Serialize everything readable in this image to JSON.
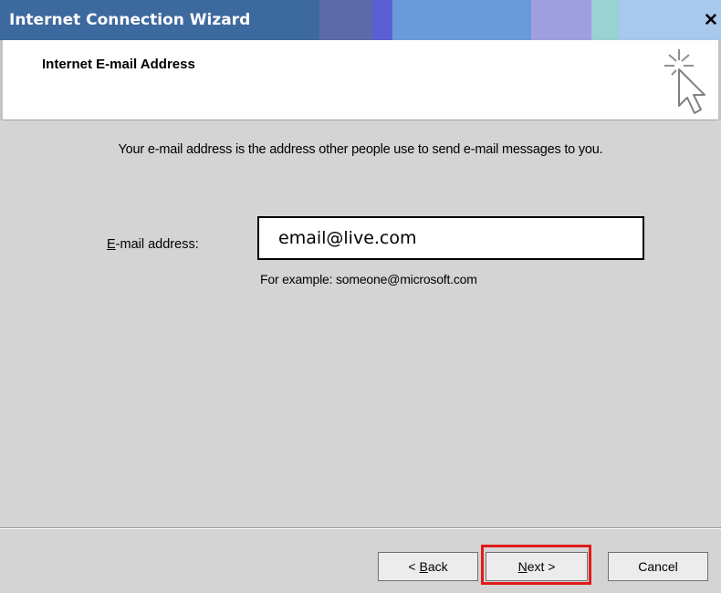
{
  "window": {
    "title": "Internet Connection Wizard",
    "close_glyph": "✕"
  },
  "header": {
    "title": "Internet E-mail Address",
    "icon": "wizard-cursor-sparkle-icon"
  },
  "main": {
    "intro": "Your e-mail address is the address other people use to send e-mail messages to you.",
    "email_label": "E-mail address:",
    "email_value": "email@live.com",
    "example_text": "For example: someone@microsoft.com"
  },
  "footer": {
    "back_label": "< Back",
    "next_label": "Next >",
    "cancel_label": "Cancel"
  },
  "colors": {
    "highlight": "#e21a1a",
    "dialog_bg": "#d4d4d4"
  }
}
